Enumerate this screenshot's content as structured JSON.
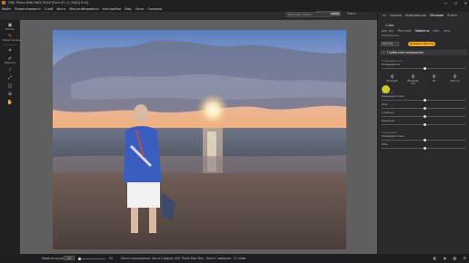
{
  "title_bar": {
    "text": "ON1 Photo RAW MAX 2025 [Fonf (F) (2 [%60] 8 Ib]"
  },
  "menu": [
    "Файл",
    "Редактировать",
    "Слой",
    "Фото",
    "Масштабировать",
    "Настройки",
    "Вид",
    "Окно",
    "Справка"
  ],
  "search": {
    "placeholder": "Быстрое поиск"
  },
  "mode_tabs": {
    "items": [
      "Смешивание",
      "Маскировка",
      "Текст"
    ],
    "active": 1
  },
  "toolbar": [
    {
      "icon": "develop-icon",
      "label": "Browse"
    },
    {
      "icon": "edit-icon",
      "label": "Редактирование"
    },
    {
      "icon": "crop-icon",
      "label": ""
    },
    {
      "icon": "brush-icon",
      "label": "Эффекты"
    },
    {
      "icon": "pen-icon",
      "label": ""
    },
    {
      "icon": "transform-icon",
      "label": ""
    },
    {
      "icon": "eraser-icon",
      "label": ""
    },
    {
      "icon": "clone-icon",
      "label": ""
    },
    {
      "icon": "hand-icon",
      "label": ""
    }
  ],
  "right_panel": {
    "tabs": [
      "нc",
      "Уровни",
      "Информация",
      "История",
      "Книга"
    ],
    "active_tab": 3,
    "layers_title": "Слои",
    "subtabs": [
      "раз..ать",
      "Местный",
      "Эффекты",
      "Нeh.",
      "Lens"
    ],
    "subtab_active": 2,
    "opacity_label": "Непрозрачн.",
    "preset_select": "Пустой",
    "preset_pill": "Добавить фильтр",
    "effect_name": "Глубинное освещение",
    "sections": {
      "top": "Освещённость",
      "brightness_label": "Освещённое",
      "lighting": "Яркость",
      "color": "Тонировка"
    },
    "bulbs": [
      "Backlight",
      "Backlight HD",
      "Sit",
      "Мягкое"
    ],
    "sliders_a": [
      {
        "label": "Передний план",
        "value": 0.5
      },
      {
        "label": "Фон",
        "value": 0.5
      },
      {
        "label": "Глубина",
        "value": 0.5
      },
      {
        "label": "Переход",
        "value": 0.5
      }
    ],
    "sliders_b": [
      {
        "label": "Передний план",
        "value": 0.5
      },
      {
        "label": "Фон",
        "value": 0.5
      }
    ]
  },
  "status_bar": {
    "nav_label": "Навигатор/ьшь",
    "zoom_value": "100",
    "zoom_percent": "54",
    "info": "Место нахождения: Фото в форму ON1 Photo Raw Max · Фото  1 выбрано · 21 элем."
  },
  "pointer": {
    "color": "#e1dc2c"
  }
}
